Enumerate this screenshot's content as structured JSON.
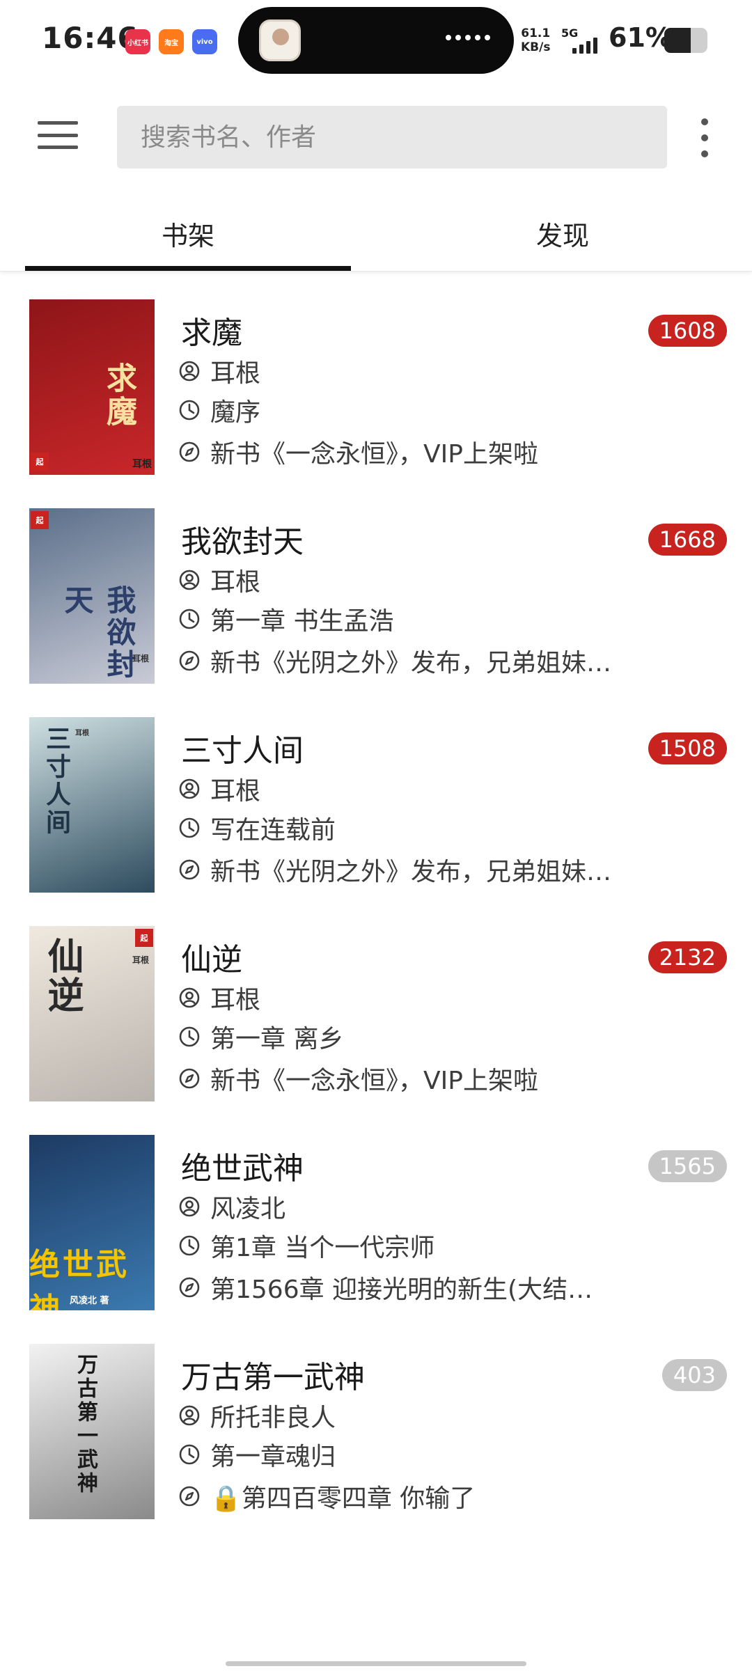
{
  "status_bar": {
    "time": "16:46",
    "notifications": [
      "小红书",
      "淘宝",
      "vivo"
    ],
    "net_speed_value": "61.1",
    "net_speed_unit": "KB/s",
    "network": "5G",
    "battery_percent": "61%",
    "battery_level": 0.61
  },
  "search": {
    "placeholder": "搜索书名、作者"
  },
  "tabs": {
    "bookshelf": "书架",
    "discover": "发现",
    "active": "bookshelf"
  },
  "books": [
    {
      "title": "求魔",
      "author": "耳根",
      "read_chapter": "魔序",
      "latest_chapter": "新书《一念永恒》，VIP上架啦",
      "unread": "1608",
      "unread_style": "red",
      "cover_title": "求魔",
      "cover_author": "耳根",
      "cover_colors": [
        "#8e1518",
        "#c9272a"
      ]
    },
    {
      "title": "我欲封天",
      "author": "耳根",
      "read_chapter": "第一章 书生孟浩",
      "latest_chapter": "新书《光阴之外》发布，兄弟姐妹…",
      "unread": "1668",
      "unread_style": "red",
      "cover_title": "我欲封天",
      "cover_author": "耳根",
      "cover_colors": [
        "#5b6f8a",
        "#c9cbd6"
      ]
    },
    {
      "title": "三寸人间",
      "author": "耳根",
      "read_chapter": "写在连载前",
      "latest_chapter": "新书《光阴之外》发布，兄弟姐妹…",
      "unread": "1508",
      "unread_style": "red",
      "cover_title": "三寸人间",
      "cover_author": "耳根",
      "cover_colors": [
        "#cfe0e2",
        "#2d4b5e"
      ]
    },
    {
      "title": "仙逆",
      "author": "耳根",
      "read_chapter": "第一章 离乡",
      "latest_chapter": "新书《一念永恒》，VIP上架啦",
      "unread": "2132",
      "unread_style": "red",
      "cover_title": "仙逆",
      "cover_author": "耳根",
      "cover_colors": [
        "#efe9df",
        "#b9b3ad"
      ]
    },
    {
      "title": "绝世武神",
      "author": "风凌北",
      "read_chapter": "第1章 当个一代宗师",
      "latest_chapter": "第1566章 迎接光明的新生(大结…",
      "unread": "1565",
      "unread_style": "grey",
      "cover_title": "绝世武神",
      "cover_author": "风凌北 著",
      "cover_colors": [
        "#1d3a63",
        "#3b7ab0"
      ]
    },
    {
      "title": "万古第一武神",
      "author": "所托非良人",
      "read_chapter": "第一章魂归",
      "latest_chapter": "🔒第四百零四章 你输了",
      "unread": "403",
      "unread_style": "grey",
      "cover_title": "万古第一武神",
      "cover_author": "",
      "cover_colors": [
        "#f2f2f2",
        "#8a8a8a"
      ]
    }
  ],
  "colors": {
    "accent_red": "#c8231e",
    "badge_grey": "#c6c6c6",
    "search_bg": "#e8e8e8",
    "tab_indicator": "#111111"
  }
}
